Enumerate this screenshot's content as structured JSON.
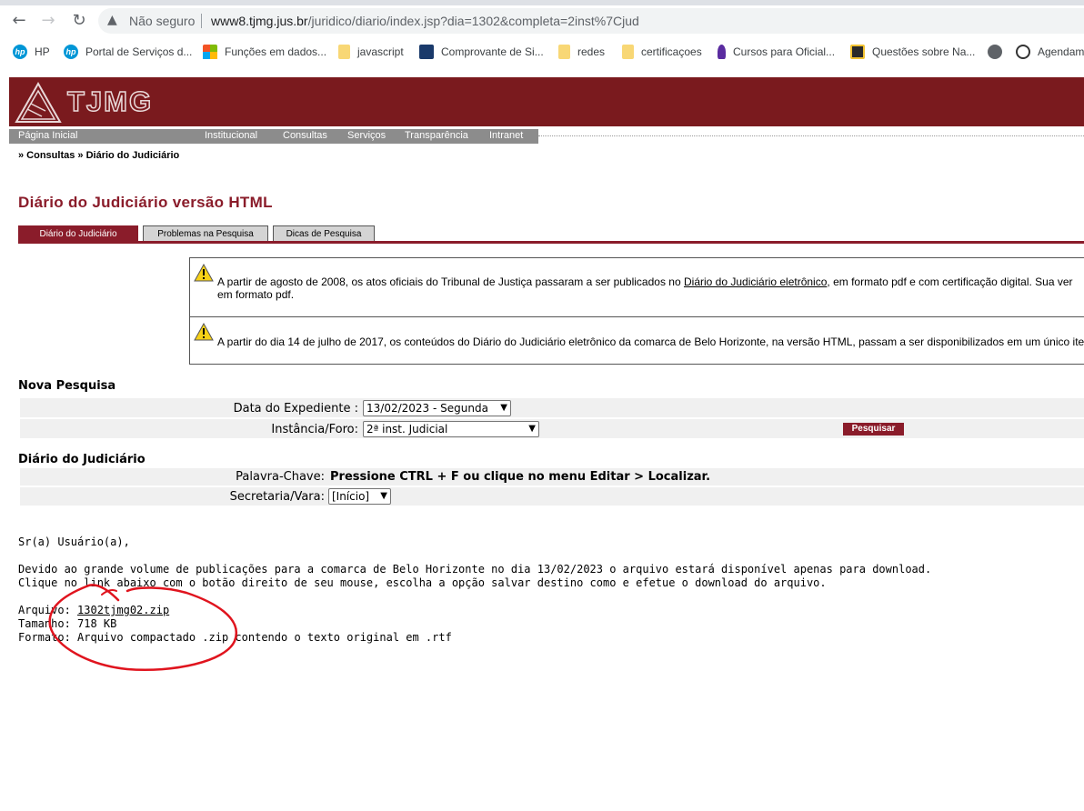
{
  "browser": {
    "security_label": "Não seguro",
    "url_host": "www8.tjmg.jus.br",
    "url_path": "/juridico/diario/index.jsp?dia=1302&completa=2inst%7Cjud",
    "nav_back": "←",
    "nav_forward": "→",
    "nav_reload": "↻",
    "security_icon": "warning-triangle-icon"
  },
  "bookmarks": [
    {
      "label": "HP",
      "icon": "hp-icon"
    },
    {
      "label": "Portal de Serviços d...",
      "icon": "hp-icon"
    },
    {
      "label": "Funções em dados...",
      "icon": "microsoft-icon"
    },
    {
      "label": "javascript",
      "icon": "folder-icon"
    },
    {
      "label": "Comprovante de Si...",
      "icon": "site-icon"
    },
    {
      "label": "redes",
      "icon": "folder-icon"
    },
    {
      "label": "certificaçoes",
      "icon": "folder-icon"
    },
    {
      "label": "Cursos para Oficial...",
      "icon": "site-icon"
    },
    {
      "label": "Questões sobre Na...",
      "icon": "checkbox-icon"
    },
    {
      "label": "",
      "icon": "globe-icon"
    },
    {
      "label": "Agendam",
      "icon": "site-icon"
    }
  ],
  "site": {
    "logo_text": "TJMG",
    "menu": {
      "home": "Página Inicial",
      "items": [
        "Institucional",
        "Consultas",
        "Serviços",
        "Transparência",
        "Intranet"
      ]
    },
    "breadcrumb": "» Consultas » Diário do Judiciário",
    "title": "Diário do Judiciário versão HTML",
    "tabs": [
      "Diário do Judiciário",
      "Problemas na Pesquisa",
      "Dicas de Pesquisa"
    ]
  },
  "notices": {
    "n1_before": "A partir de agosto de 2008, os atos oficiais do Tribunal de Justiça passaram a ser publicados no ",
    "n1_link": "Diário do Judiciário eletrônico",
    "n1_after": ", em formato pdf e com certificação digital. Sua ver",
    "n1_line2": "em formato pdf.",
    "n2": "A partir do dia 14 de julho de 2017, os conteúdos do Diário do Judiciário eletrônico da comarca de Belo Horizonte, na versão HTML, passam a ser disponibilizados em um único ite"
  },
  "search": {
    "heading": "Nova Pesquisa",
    "date_label": "Data do Expediente :",
    "date_value": "13/02/2023 - Segunda",
    "forum_label": "Instância/Foro:",
    "forum_value": "2ª inst. Judicial",
    "submit": "Pesquisar"
  },
  "diario": {
    "heading": "Diário do Judiciário",
    "keyword_label": "Palavra-Chave:",
    "keyword_hint": "Pressione CTRL + F ou clique no menu Editar > Localizar.",
    "vara_label": "Secretaria/Vara:",
    "vara_value": "[Início]"
  },
  "message": {
    "greeting": "Sr(a) Usuário(a),",
    "line1": "Devido ao grande volume de publicações para a comarca de Belo Horizonte no dia 13/02/2023 o arquivo estará disponível apenas para download.",
    "line2": "Clique no link abaixo com o botão direito de seu mouse, escolha a opção salvar destino como e efetue o download do arquivo.",
    "file_label": "Arquivo:",
    "file_name": "1302tjmg02.zip",
    "size_label": "Tamanho:",
    "size_value": "718 KB",
    "format_label": "Formato:",
    "format_value": "Arquivo compactado .zip contendo o texto original em .rtf"
  },
  "colors": {
    "brand": "#7a1a1e",
    "accent": "#8a1c2a",
    "annotation": "#e0141e"
  }
}
